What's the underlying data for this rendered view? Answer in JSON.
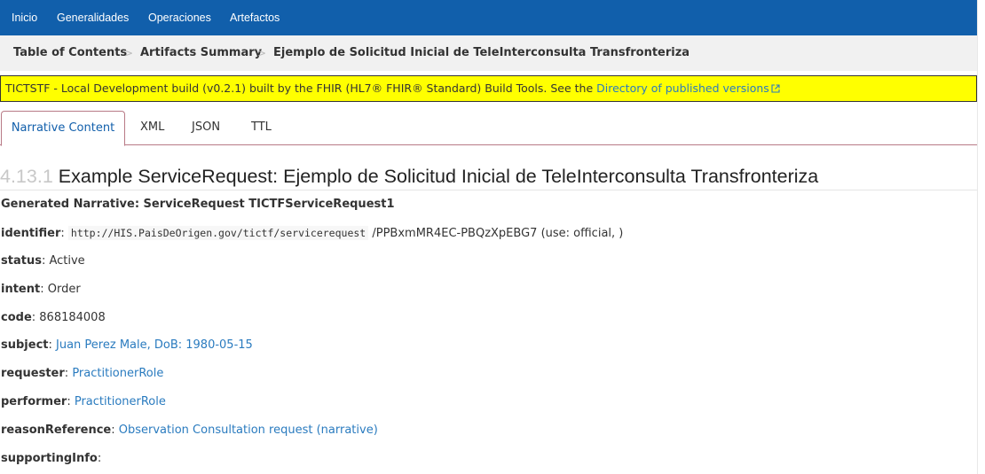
{
  "nav": {
    "items": [
      "Inicio",
      "Generalidades",
      "Operaciones",
      "Artefactos"
    ],
    "background": "#115fab"
  },
  "breadcrumb": {
    "items": [
      "Table of Contents",
      "Artifacts Summary",
      "Ejemplo de Solicitud Inicial de TeleInterconsulta Transfronteriza"
    ],
    "separator": ">"
  },
  "banner": {
    "text": "TICTSTF - Local Development build (v0.2.1) built by the FHIR (HL7® FHIR® Standard) Build Tools. See the ",
    "link": "Directory of published versions",
    "background": "#ffff00",
    "link_icon": "external-link-icon"
  },
  "tabs": [
    "Narrative Content",
    "XML",
    "JSON",
    "TTL"
  ],
  "active_tab": "Narrative Content",
  "heading": {
    "number": "4.13.1",
    "title": "Example ServiceRequest: Ejemplo de Solicitud Inicial de TeleInterconsulta Transfronteriza"
  },
  "narrative": {
    "generated": "Generated Narrative: ServiceRequest TICTFServiceRequest1",
    "identifier": {
      "label": "identifier",
      "system": "http://HIS.PaisDeOrigen.gov/tictf/servicerequest",
      "value": "/PPBxmMR4EC-PBQzXpEBG7 (use: official, )"
    },
    "status": {
      "label": "status",
      "value": "Active"
    },
    "intent": {
      "label": "intent",
      "value": "Order"
    },
    "code": {
      "label": "code",
      "value": "868184008"
    },
    "subject": {
      "label": "subject",
      "value": "Juan Perez Male, DoB: 1980-05-15"
    },
    "requester": {
      "label": "requester",
      "value": "PractitionerRole"
    },
    "performer": {
      "label": "performer",
      "value": "PractitionerRole"
    },
    "reasonReference": {
      "label": "reasonReference",
      "value": "Observation Consultation request (narrative)"
    },
    "supportingInfo": {
      "label": "supportingInfo",
      "value": ""
    }
  },
  "colors": {
    "link": "#2a7bbf",
    "tab_border": "#b87a86",
    "heading_number": "#c8c8c8"
  }
}
